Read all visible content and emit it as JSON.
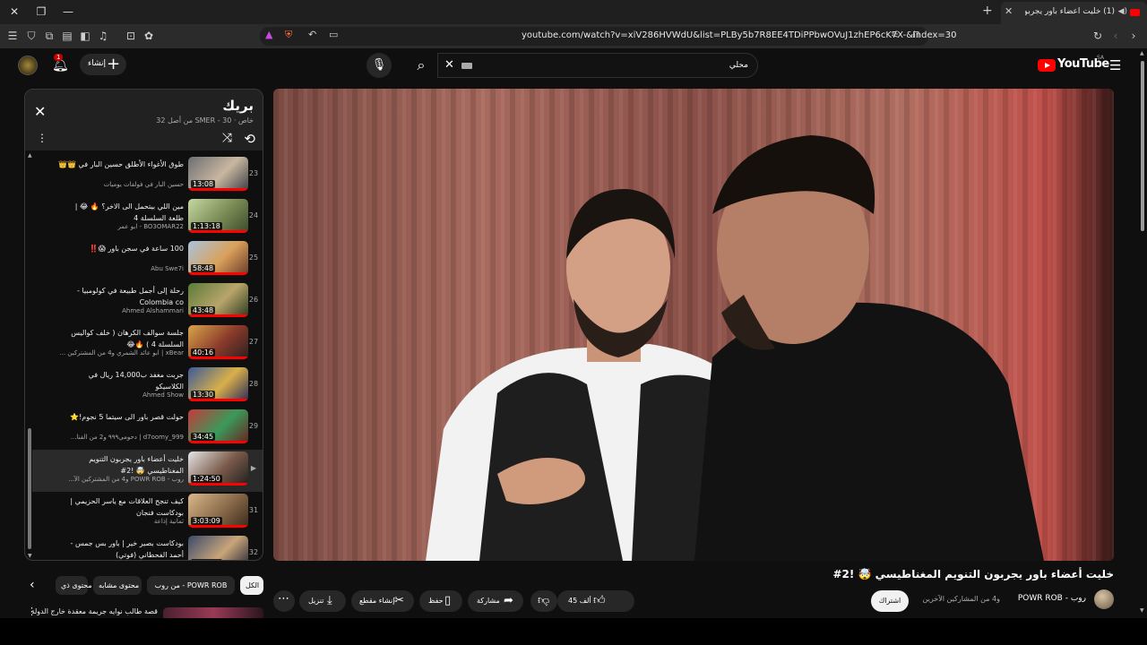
{
  "browser": {
    "tab_title": "(1) خليت أعضاء باور يجربون التن...",
    "url": "youtube.com/watch?v=xiV286HVWdU&list=PLBy5b7R8EE4TDiPPbwOVuJ1zhEP6cK7X-&index=30"
  },
  "masthead": {
    "logo_text": "YouTube",
    "country": "SA",
    "search_query": "محلي",
    "create_label": "إنشاء",
    "notif_count": "1"
  },
  "playlist": {
    "title": "بريك",
    "subtitle": "خاص · SMER - 30 من أصل 32",
    "items": [
      {
        "index": "23",
        "title": "طوق الأغواء الأطلق حسين البار في 👑👑",
        "channel": "حسين البار في فولفات يوميات",
        "duration": "13:08",
        "colors": [
          "#6b6e72",
          "#c9b7a0",
          "#3b3f46"
        ]
      },
      {
        "index": "24",
        "title": "مين اللي بيتحمل الى الاخر؟ 🔥 😂 | طلعة السلسلة 4",
        "channel": "BO3OMAR22 - ابو عمر",
        "duration": "1:13:18",
        "colors": [
          "#c4d9a3",
          "#7a8a55",
          "#3b4a2a"
        ]
      },
      {
        "index": "25",
        "title": "100 ساعة في سجن باور 😱‼️",
        "channel": "Abu Swe7i",
        "duration": "58:48",
        "colors": [
          "#a9c3de",
          "#d9a15a",
          "#6b3a2a"
        ]
      },
      {
        "index": "26",
        "title": "رحلة إلى أجمل طبيعة في كولومبيا - Colombia co",
        "channel": "Ahmed Alshammari",
        "duration": "43:48",
        "colors": [
          "#5a7a3a",
          "#b9a56a",
          "#2a3a20"
        ]
      },
      {
        "index": "27",
        "title": "جلسة سوالف الكرهان ( خلف كواليس السلسلة 4 ) 🔥😂",
        "channel": "xBear | ابو عائد الشمري و4 من المشتركين ...",
        "duration": "40:16",
        "colors": [
          "#d9a54a",
          "#8a3a2a",
          "#2a2020"
        ]
      },
      {
        "index": "28",
        "title": "جربت مغفد ب14,000 ريال في الكلاسيكو",
        "channel": "Ahmed Show",
        "duration": "13:30",
        "colors": [
          "#3a5a9a",
          "#d9b04a",
          "#2a2a5a"
        ]
      },
      {
        "index": "29",
        "title": "حولت قصر باور الى سيتما 5 نجوم!⭐",
        "channel": "d7oomy_999 | دحومي٩٩٩ و2 من الفنا...",
        "duration": "34:45",
        "colors": [
          "#c43a3a",
          "#3a9a5a",
          "#6a2020"
        ]
      },
      {
        "index": "30",
        "title": "خليت أعضاء باور يجربون التنويم المغناطيسي 🤯 !2#",
        "channel": "روب - POWR ROB و4 من المشتركين الآ...",
        "duration": "1:24:50",
        "colors": [
          "#e6e6e6",
          "#7a5a4a",
          "#202020"
        ],
        "active": true
      },
      {
        "index": "31",
        "title": "كيف تنجح العلاقات مع ياسر الحزيمي | بودكاست فنجان",
        "channel": "ثمانية إذاعة",
        "duration": "3:03:09",
        "colors": [
          "#d9b88a",
          "#8a6a4a",
          "#3a2a1a"
        ]
      },
      {
        "index": "32",
        "title": "بودكاست بصير خير | باور بس جمس - أحمد الفحطاني (فوتي)",
        "channel": "جام ستديو",
        "duration": "1:55:37",
        "colors": [
          "#3a4a6a",
          "#c9a57a",
          "#1a2030"
        ]
      }
    ]
  },
  "video": {
    "title": "خليت أعضاء باور يجربون التنويم المغناطيسي 🤯 !2#",
    "channel_name": "روب - POWR ROB",
    "channel_extra": "و4 من المشاركين الآخرين",
    "subscribe_label": "اشتراك",
    "like_count": "45 ألف",
    "share_label": "مشاركة",
    "save_label": "حفظ",
    "clip_label": "إنشاء مقطع",
    "download_label": "تنزيل"
  },
  "chips": [
    {
      "label": "الكل",
      "selected": true
    },
    {
      "label": "من روب - POWR ROB",
      "selected": false
    },
    {
      "label": "محتوى مشابه",
      "selected": false
    },
    {
      "label": "محتوى ذي",
      "selected": false
    }
  ],
  "recommendation": {
    "title": "قصة طالب نوايه جريمة معقدة خارج الدولة (..."
  },
  "icons": {
    "close": "close-icon",
    "menu": "kebab-icon",
    "shuffle": "shuffle-icon",
    "loop": "loop-icon",
    "search": "search-icon",
    "mic": "mic-icon",
    "bell": "bell-icon",
    "hamburger": "hamburger-icon"
  },
  "colors": {
    "accent": "#ff0000",
    "background": "#0f0f0f",
    "surface": "#272727"
  }
}
